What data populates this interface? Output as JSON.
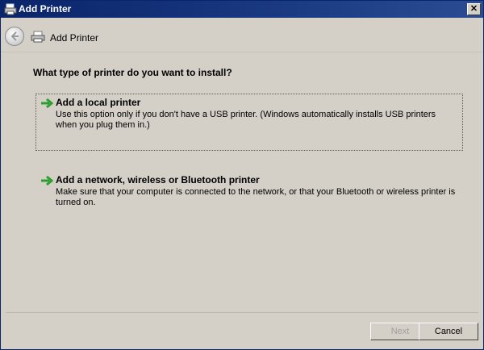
{
  "window": {
    "title": "Add Printer",
    "close_glyph": "✕"
  },
  "nav": {
    "title": "Add Printer"
  },
  "main": {
    "question": "What type of printer do you want to install?",
    "options": [
      {
        "title": "Add a local printer",
        "description": "Use this option only if you don't have a USB printer. (Windows automatically installs USB printers when you plug them in.)",
        "icon": "green-arrow-icon"
      },
      {
        "title": "Add a network, wireless or Bluetooth printer",
        "description": "Make sure that your computer is connected to the network, or that your Bluetooth or wireless printer is turned on.",
        "icon": "green-arrow-icon"
      }
    ]
  },
  "footer": {
    "next_label": "Next",
    "cancel_label": "Cancel"
  },
  "colors": {
    "title_bar": "#0a246a",
    "background": "#d4d0c8",
    "arrow": "#2e9e2e"
  }
}
